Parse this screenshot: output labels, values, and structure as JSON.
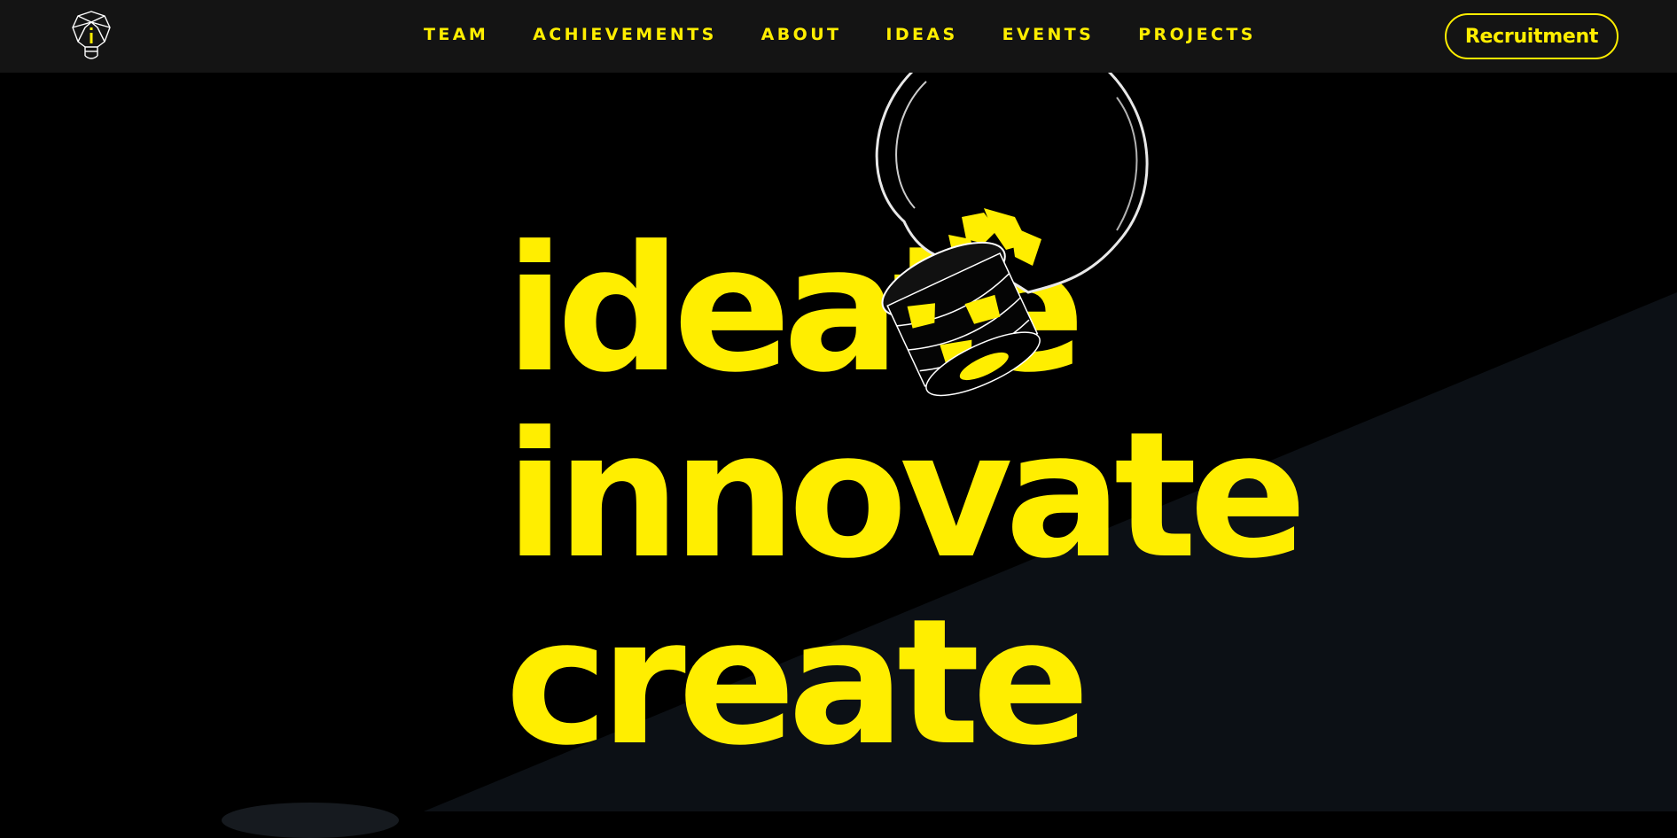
{
  "navbar": {
    "logo_icon": "lightbulb-logo-icon",
    "links": [
      {
        "label": "TEAM"
      },
      {
        "label": "ACHIEVEMENTS"
      },
      {
        "label": "ABOUT"
      },
      {
        "label": "IDEAS"
      },
      {
        "label": "EVENTS"
      },
      {
        "label": "PROJECTS"
      }
    ],
    "cta_label": "Recruitment"
  },
  "hero": {
    "words": [
      "ideate",
      "innovate",
      "create"
    ],
    "image_icon": "lightbulb-illustration"
  },
  "colors": {
    "accent": "#ffee00",
    "background": "#000000",
    "navbar": "#141414",
    "panel": "#0c1015"
  }
}
